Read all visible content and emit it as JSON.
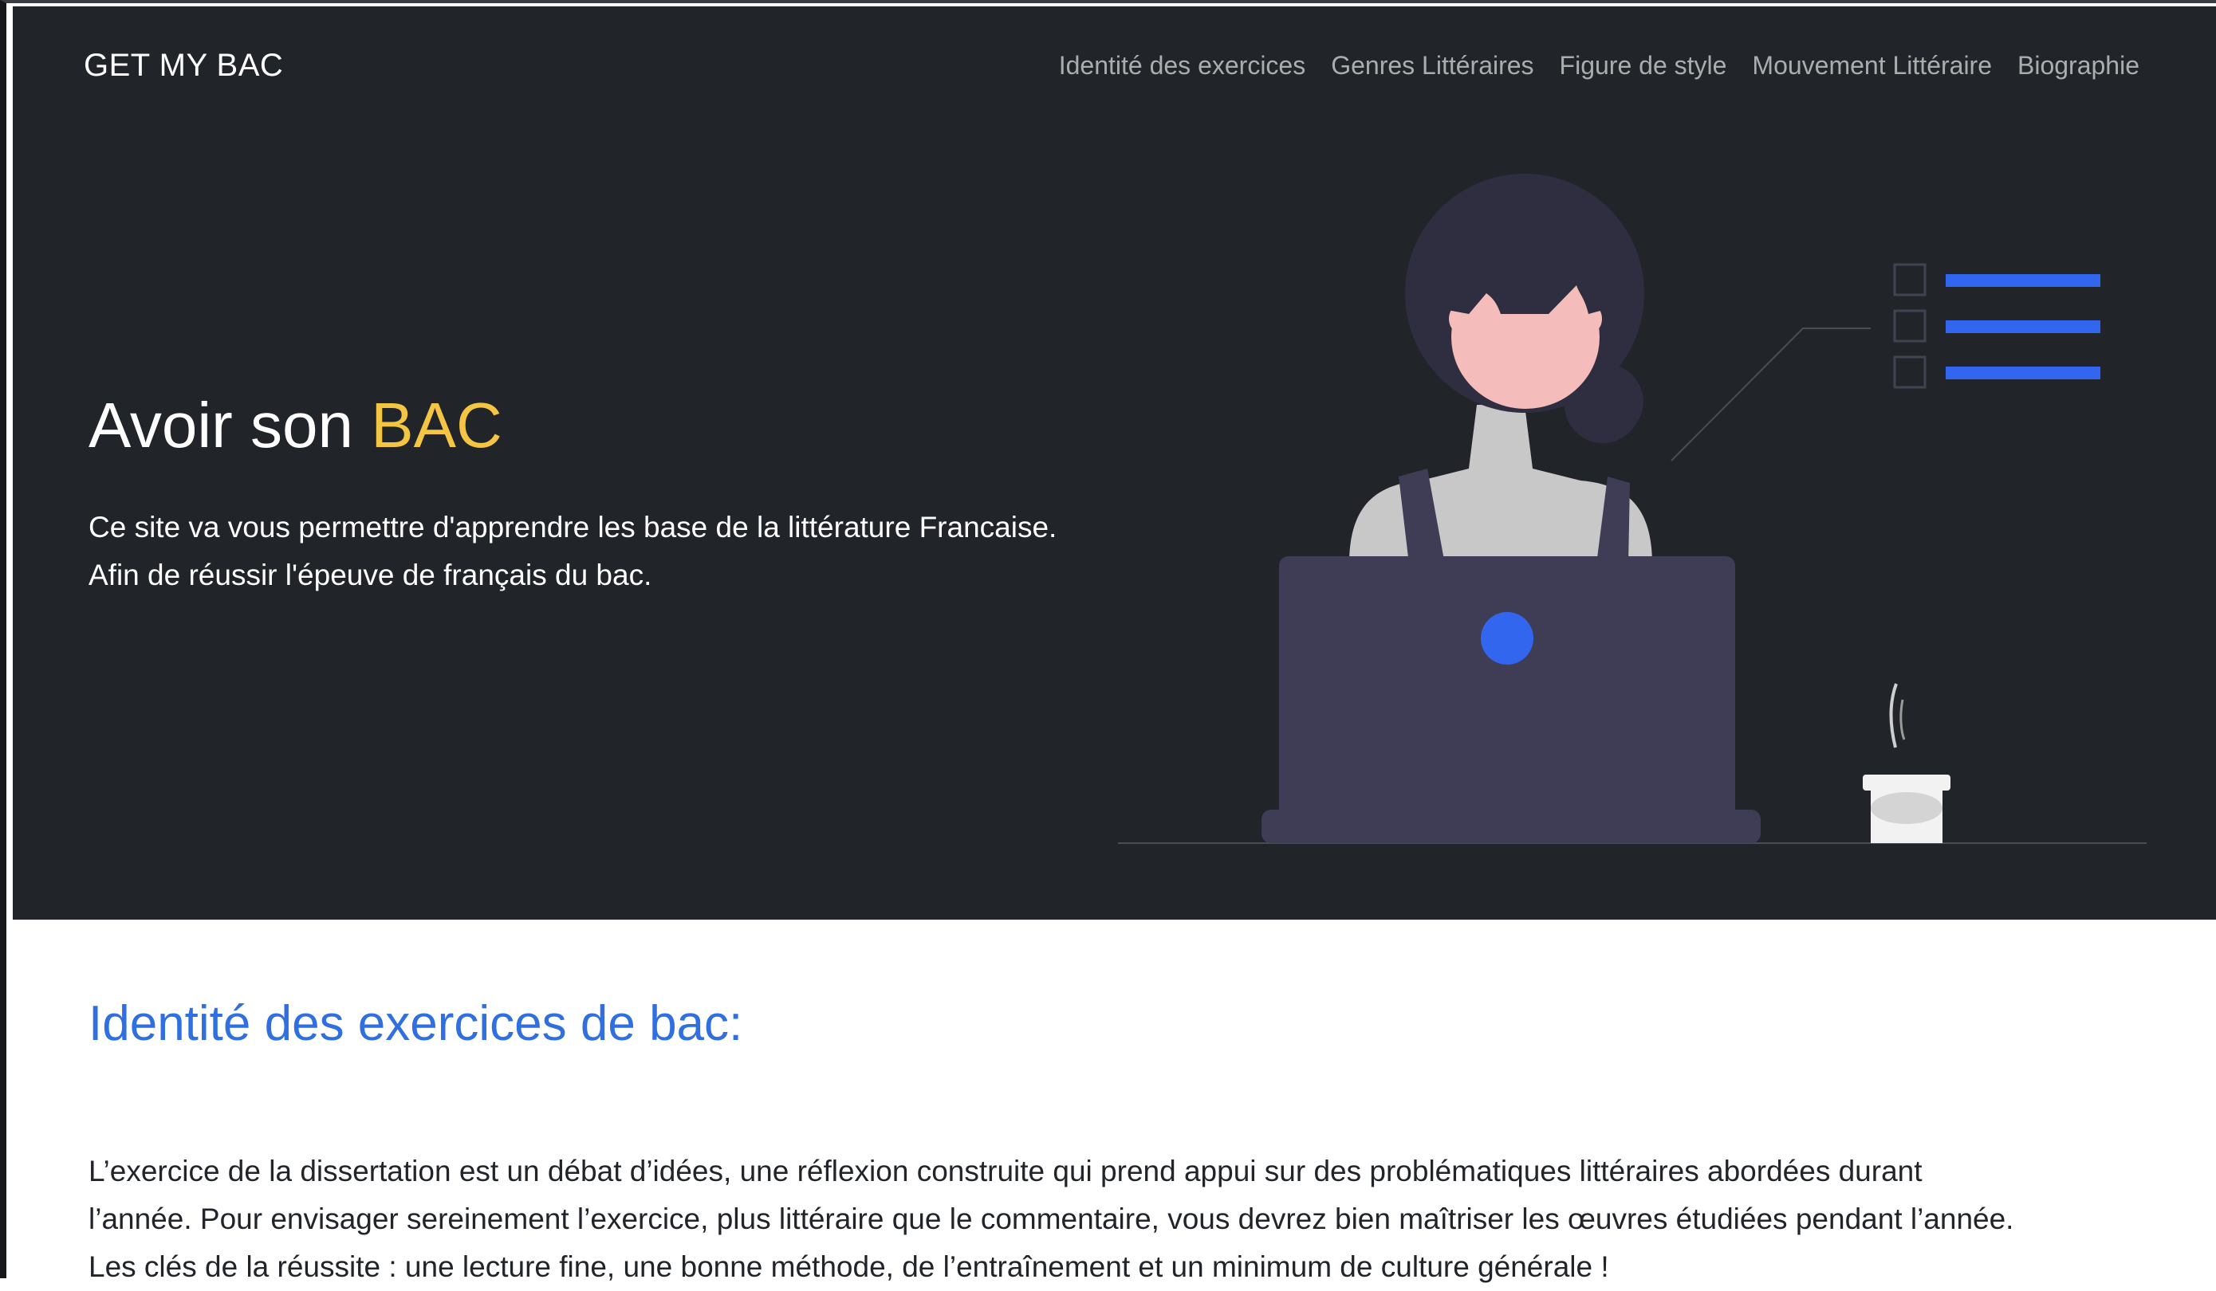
{
  "navbar": {
    "brand": "GET MY BAC",
    "links": [
      "Identité des exercices",
      "Genres Littéraires",
      "Figure de style",
      "Mouvement Littéraire",
      "Biographie"
    ]
  },
  "hero": {
    "title_prefix": "Avoir son",
    "title_accent": "BAC",
    "lead_line1": "Ce site va vous permettre d'apprendre les base de la littérature Francaise.",
    "lead_line2": "Afin de réussir l'épeuve de français du bac.",
    "illustration": "woman-at-laptop-illustration"
  },
  "section": {
    "title": "Identité des exercices de bac:",
    "line1": "L’exercice de la dissertation est un débat d’idées, une réflexion construite qui prend appui sur des problématiques littéraires abordées durant",
    "line2": "l’année. Pour envisager sereinement l’exercice, plus littéraire que le commentaire, vous devrez bien maîtriser les œuvres étudiées pendant l’année.",
    "line3": "Les clés de la réussite : une lecture fine, une bonne méthode, de l’entraînement et un minimum de culture générale !"
  },
  "colors": {
    "hero_bg": "#212529",
    "accent_yellow": "#f4c542",
    "heading_blue": "#2f6fe0",
    "illustration_blue": "#3366ee",
    "laptop": "#3f3d56"
  }
}
